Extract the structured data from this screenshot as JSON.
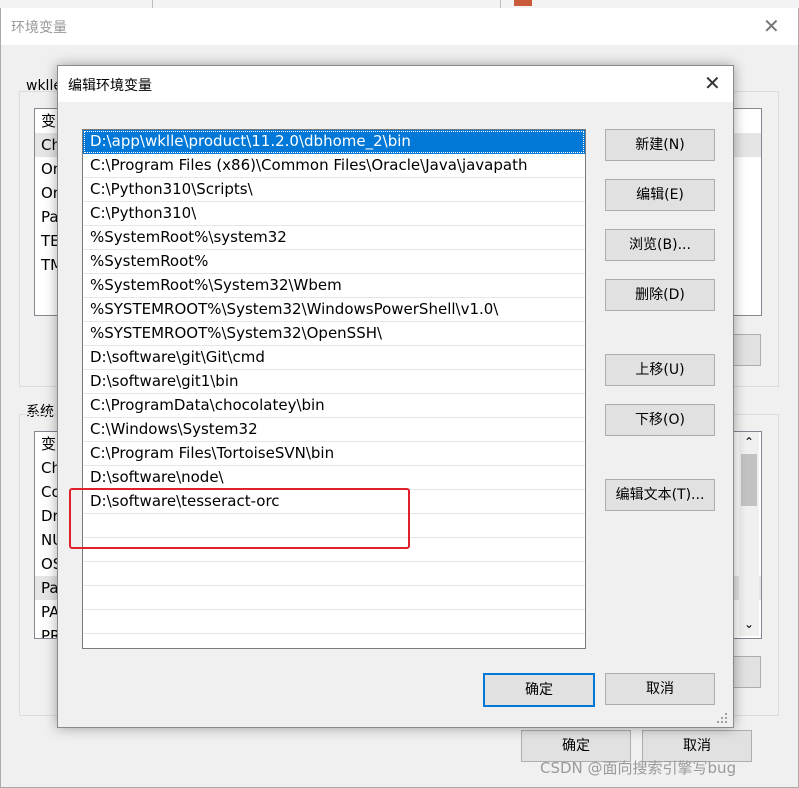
{
  "background_window": {
    "title": "环境变量",
    "user_group_label": "wklle",
    "user_list": {
      "header": "变",
      "rows": [
        "Ch",
        "On",
        "On",
        "Pa",
        "TE",
        "TM"
      ]
    },
    "system_group_label": "系统",
    "system_list": {
      "header": "变",
      "rows": [
        "Ch",
        "Co",
        "Dr",
        "NU",
        "OS",
        "Pa",
        "PA",
        "PR"
      ]
    },
    "ok_label": "确定",
    "cancel_label": "取消"
  },
  "dialog": {
    "title": "编辑环境变量",
    "paths": [
      "D:\\app\\wklle\\product\\11.2.0\\dbhome_2\\bin",
      "C:\\Program Files (x86)\\Common Files\\Oracle\\Java\\javapath",
      "C:\\Python310\\Scripts\\",
      "C:\\Python310\\",
      "%SystemRoot%\\system32",
      "%SystemRoot%",
      "%SystemRoot%\\System32\\Wbem",
      "%SYSTEMROOT%\\System32\\WindowsPowerShell\\v1.0\\",
      "%SYSTEMROOT%\\System32\\OpenSSH\\",
      "D:\\software\\git\\Git\\cmd",
      "D:\\software\\git1\\bin",
      "C:\\ProgramData\\chocolatey\\bin",
      "C:\\Windows\\System32",
      "C:\\Program Files\\TortoiseSVN\\bin",
      "D:\\software\\node\\",
      "D:\\software\\tesseract-orc",
      "",
      "",
      "",
      "",
      ""
    ],
    "buttons": {
      "new": "新建(N)",
      "edit": "编辑(E)",
      "browse": "浏览(B)...",
      "delete": "删除(D)",
      "move_up": "上移(U)",
      "move_down": "下移(O)",
      "edit_text": "编辑文本(T)...",
      "ok": "确定",
      "cancel": "取消"
    }
  },
  "watermark": "CSDN @面向搜索引擎写bug",
  "colors": {
    "selection": "#0078d7",
    "highlight_box": "#e0202a",
    "face": "#f0f0f0"
  }
}
